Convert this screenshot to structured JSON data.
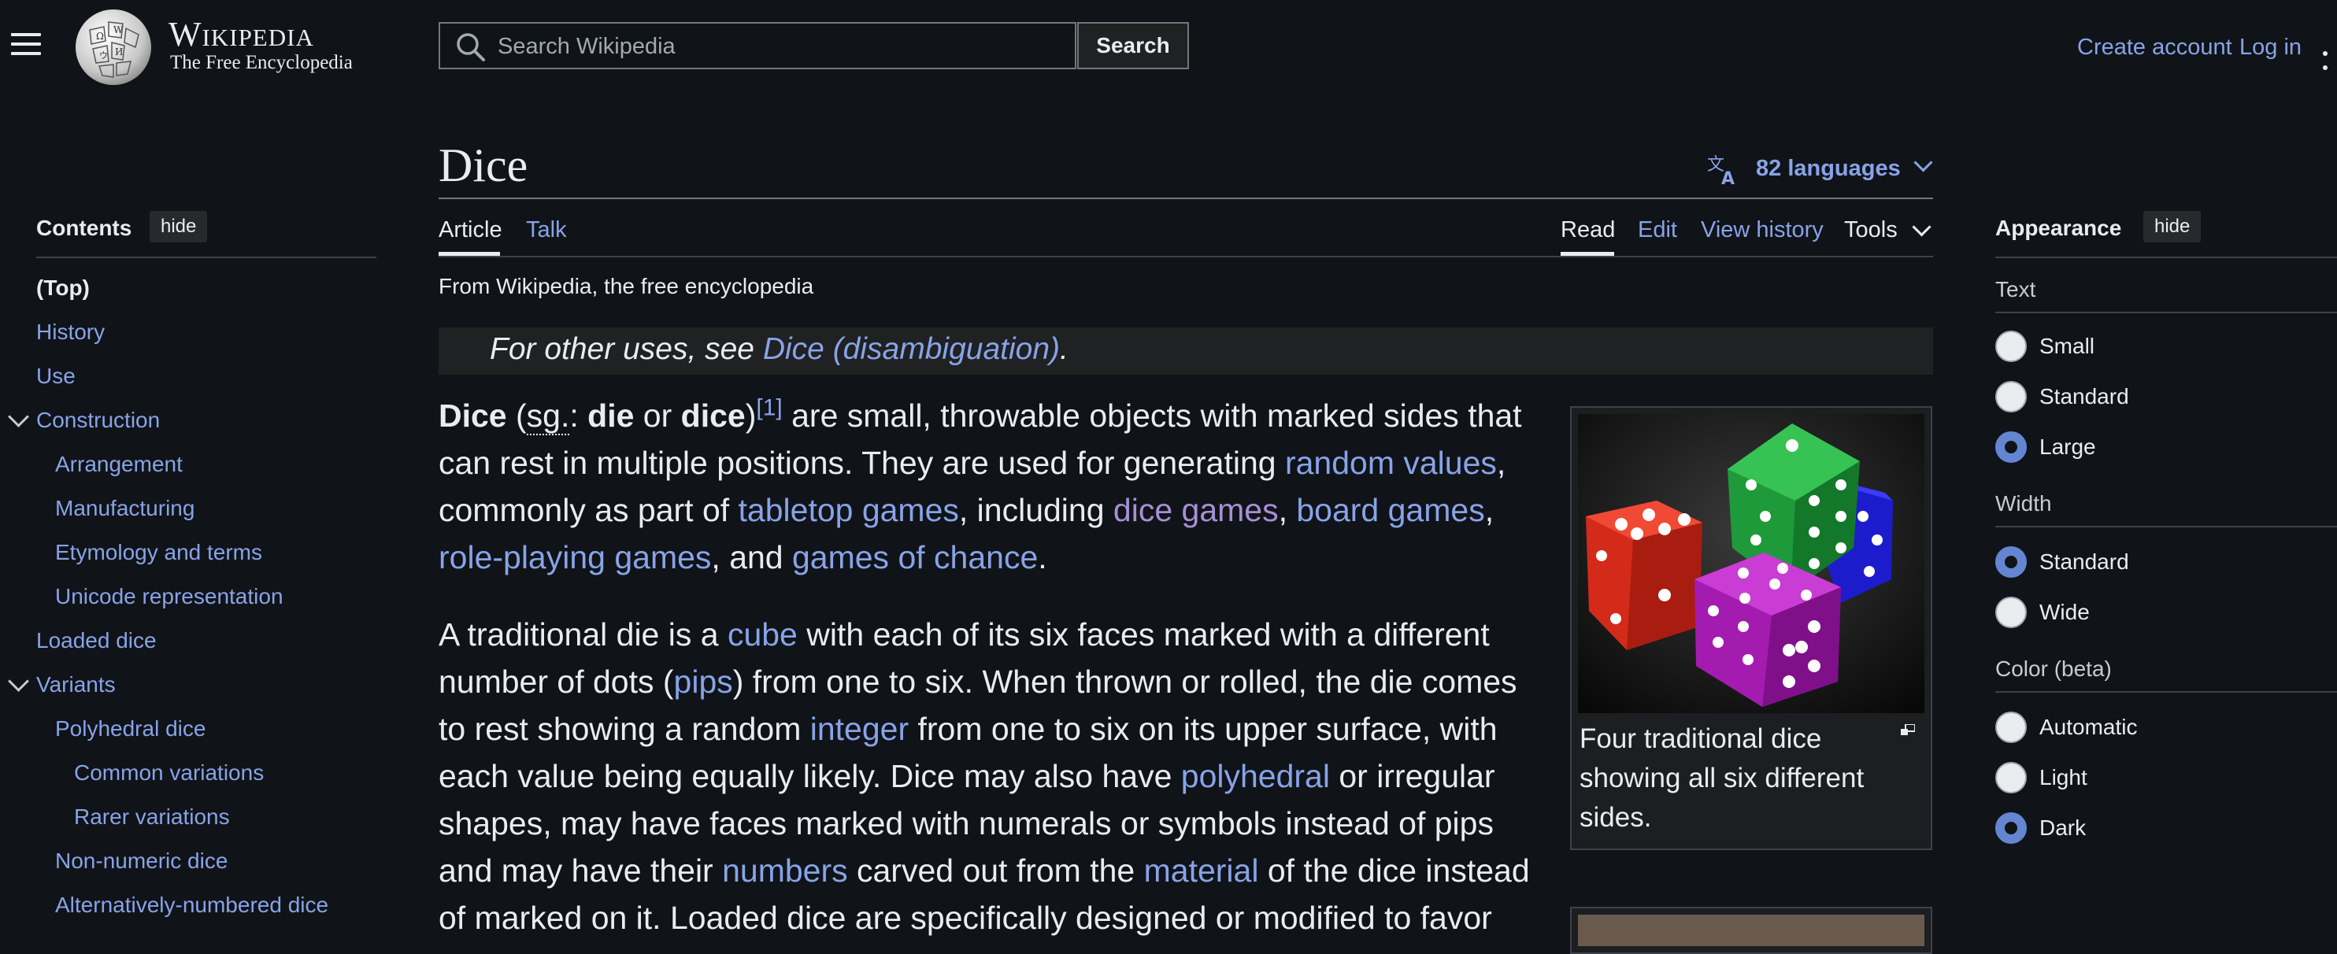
{
  "header": {
    "wordmark": "Wikipedia",
    "tagline": "The Free Encyclopedia",
    "search_placeholder": "Search Wikipedia",
    "search_button": "Search",
    "create_account": "Create account",
    "log_in": "Log in"
  },
  "toc": {
    "title": "Contents",
    "hide_label": "hide",
    "items": [
      {
        "label": "(Top)",
        "level": 0,
        "bold": true
      },
      {
        "label": "History",
        "level": 0
      },
      {
        "label": "Use",
        "level": 0
      },
      {
        "label": "Construction",
        "level": 0,
        "expanded": true
      },
      {
        "label": "Arrangement",
        "level": 1
      },
      {
        "label": "Manufacturing",
        "level": 1
      },
      {
        "label": "Etymology and terms",
        "level": 1
      },
      {
        "label": "Unicode representation",
        "level": 1
      },
      {
        "label": "Loaded dice",
        "level": 0
      },
      {
        "label": "Variants",
        "level": 0,
        "expanded": true
      },
      {
        "label": "Polyhedral dice",
        "level": 1
      },
      {
        "label": "Common variations",
        "level": 2
      },
      {
        "label": "Rarer variations",
        "level": 2
      },
      {
        "label": "Non-numeric dice",
        "level": 1
      },
      {
        "label": "Alternatively-numbered dice",
        "level": 1
      }
    ]
  },
  "article": {
    "title": "Dice",
    "languages": "82 languages",
    "tabs": {
      "article": "Article",
      "talk": "Talk",
      "read": "Read",
      "edit": "Edit",
      "history": "View history",
      "tools": "Tools"
    },
    "from_line": "From Wikipedia, the free encyclopedia",
    "hatnote": {
      "prefix": "For other uses, see ",
      "link": "Dice (disambiguation)",
      "suffix": "."
    },
    "p1": {
      "l1": {
        "b1": "Dice",
        "t1": " (",
        "abbr": "sg.",
        "t2": ": ",
        "b2": "die",
        "t3": " or ",
        "b3": "dice",
        "t4": ")",
        "ref": "[1]",
        "t5": " are small, throwable objects with marked sides that"
      },
      "l2": {
        "t1": "can rest in multiple positions. They are used for generating ",
        "a1": "random values",
        "t2": ","
      },
      "l3": {
        "t1": "commonly as part of ",
        "a1": "tabletop games",
        "t2": ", including ",
        "a2": "dice games",
        "t3": ", ",
        "a3": "board games",
        "t4": ","
      },
      "l4": {
        "a1": "role-playing games",
        "t1": ", and ",
        "a2": "games of chance",
        "t2": "."
      }
    },
    "p2": {
      "l1": {
        "t1": "A traditional die is a ",
        "a1": "cube",
        "t2": " with each of its six faces marked with a different"
      },
      "l2": {
        "t1": "number of dots (",
        "a1": "pips",
        "t2": ") from one to six. When thrown or rolled, the die comes"
      },
      "l3": {
        "t1": "to rest showing a random ",
        "a1": "integer",
        "t2": " from one to six on its upper surface, with"
      },
      "l4": {
        "t1": "each value being equally likely. Dice may also have ",
        "a1": "polyhedral",
        "t2": " or irregular"
      },
      "l5": {
        "t1": "shapes, may have faces marked with numerals or symbols instead of pips"
      },
      "l6": {
        "t1": "and may have their ",
        "a1": "numbers",
        "t2": " carved out from the ",
        "a2": "material",
        "t3": " of the dice instead"
      },
      "l7": {
        "t1": "of marked on it. Loaded dice are specifically designed or modified to favor"
      }
    },
    "infobox": {
      "caption": "Four traditional dice showing all six different sides."
    }
  },
  "appearance": {
    "title": "Appearance",
    "hide_label": "hide",
    "text_section": "Text",
    "text_options": [
      "Small",
      "Standard",
      "Large"
    ],
    "text_selected": "Large",
    "width_section": "Width",
    "width_options": [
      "Standard",
      "Wide"
    ],
    "width_selected": "Standard",
    "color_section": "Color (beta)",
    "color_options": [
      "Automatic",
      "Light",
      "Dark"
    ],
    "color_selected": "Dark"
  },
  "colors": {
    "background": "#101418",
    "link": "#88a3e8",
    "visited_link": "#a88fd6",
    "radio_selected": "#6485d1"
  }
}
